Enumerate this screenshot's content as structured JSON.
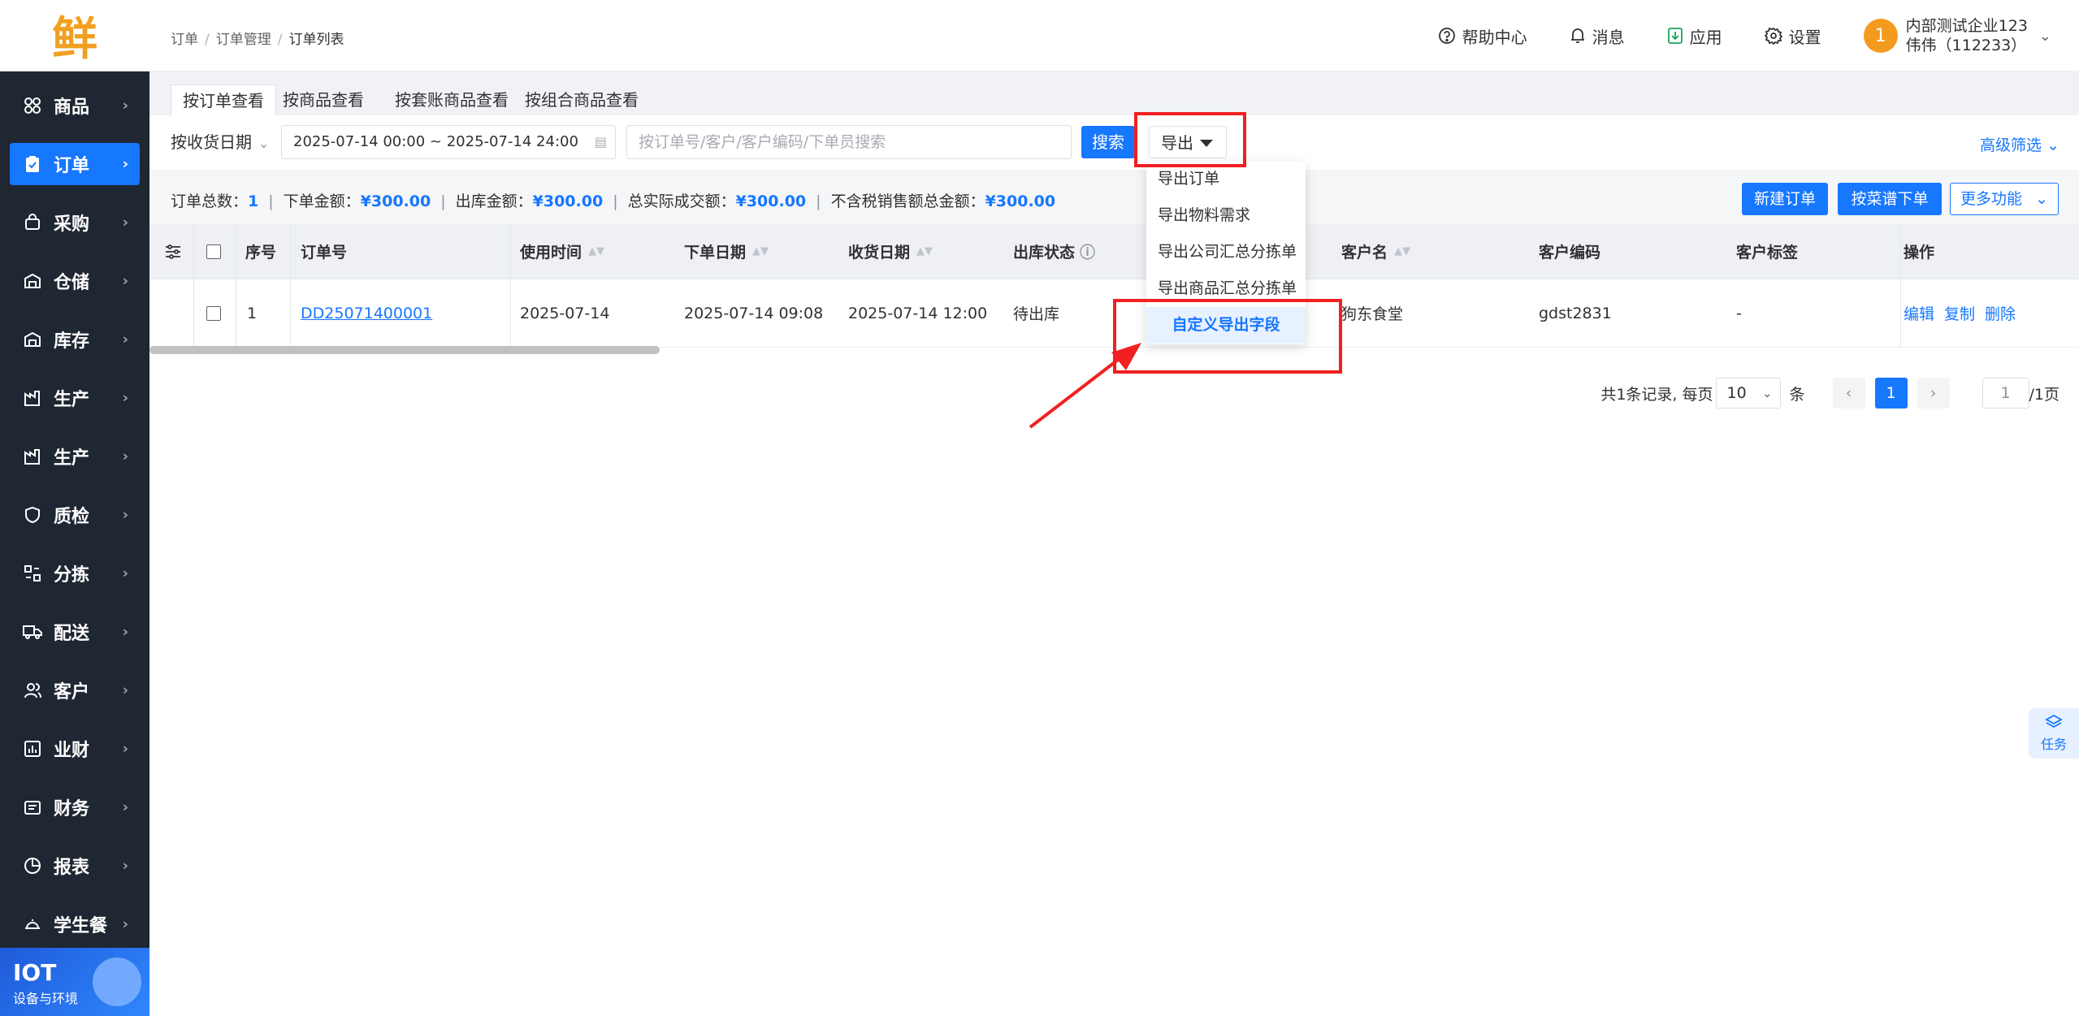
{
  "logo": {
    "text": "鲜",
    "color": "#f0a020"
  },
  "sidebar": {
    "items": [
      {
        "label": "商品",
        "icon": "apps-icon",
        "active": false
      },
      {
        "label": "订单",
        "icon": "clipboard-icon",
        "active": true
      },
      {
        "label": "采购",
        "icon": "shopping-bag-icon",
        "active": false
      },
      {
        "label": "仓储",
        "icon": "warehouse-icon",
        "active": false
      },
      {
        "label": "库存",
        "icon": "inventory-icon",
        "active": false
      },
      {
        "label": "生产",
        "icon": "factory-icon",
        "active": false
      },
      {
        "label": "生产",
        "icon": "factory-icon",
        "active": false
      },
      {
        "label": "质检",
        "icon": "shield-icon",
        "active": false
      },
      {
        "label": "分拣",
        "icon": "sort-icon",
        "active": false
      },
      {
        "label": "配送",
        "icon": "truck-icon",
        "active": false
      },
      {
        "label": "客户",
        "icon": "users-icon",
        "active": false
      },
      {
        "label": "业财",
        "icon": "bar-chart-icon",
        "active": false
      },
      {
        "label": "财务",
        "icon": "wallet-icon",
        "active": false
      },
      {
        "label": "报表",
        "icon": "pie-chart-icon",
        "active": false
      },
      {
        "label": "学生餐",
        "icon": "dish-icon",
        "active": false
      }
    ],
    "iot": {
      "title": "IOT",
      "subtitle": "设备与环境"
    }
  },
  "header": {
    "breadcrumb": [
      "订单",
      "订单管理",
      "订单列表"
    ],
    "help": "帮助中心",
    "messages": "消息",
    "apps": "应用",
    "settings": "设置",
    "user": {
      "avatar": "1",
      "company": "内部测试企业123",
      "name": "伟伟（112233）"
    }
  },
  "tabs": [
    "按订单查看",
    "按商品查看",
    "按套账商品查看",
    "按组合商品查看"
  ],
  "filter": {
    "date_type": "按收货日期",
    "date_range": "2025-07-14 00:00 ~ 2025-07-14 24:00",
    "search_placeholder": "按订单号/客户/客户编码/下单员搜索",
    "search_button": "搜索",
    "export_button": "导出",
    "advanced": "高级筛选"
  },
  "summary": {
    "order_count_label": "订单总数：",
    "order_count": "1",
    "order_amount_label": "下单金额：",
    "order_amount": "¥300.00",
    "outbound_amount_label": "出库金额：",
    "outbound_amount": "¥300.00",
    "actual_amount_label": "总实际成交额：",
    "actual_amount": "¥300.00",
    "notax_amount_label": "不含税销售额总金额：",
    "notax_amount": "¥300.00",
    "new_order": "新建订单",
    "menu_order": "按菜谱下单",
    "more": "更多功能"
  },
  "table": {
    "headers": {
      "index": "序号",
      "order_no": "订单号",
      "use_time": "使用时间",
      "order_date": "下单日期",
      "receive_date": "收货日期",
      "out_status": "出库状态",
      "customer": "客户名",
      "customer_code": "客户编码",
      "customer_tag": "客户标签",
      "ops": "操作"
    },
    "rows": [
      {
        "index": "1",
        "order_no": "DD25071400001",
        "use_time": "2025-07-14",
        "order_date": "2025-07-14 09:08",
        "receive_date": "2025-07-14 12:00",
        "out_status": "待出库",
        "customer": "狗东食堂",
        "customer_code": "gdst2831",
        "customer_tag": "-",
        "edit": "编辑",
        "copy": "复制",
        "delete": "删除"
      }
    ]
  },
  "pagination": {
    "summary": "共1条记录, 每页",
    "page_size": "10",
    "unit": "条",
    "current": "1",
    "jump": "1",
    "total_pages": "/1页"
  },
  "export_menu": {
    "items": [
      "导出订单",
      "导出物料需求",
      "导出公司汇总分拣单",
      "导出商品汇总分拣单",
      "自定义导出字段"
    ],
    "highlighted": "自定义导出字段"
  },
  "task_button": "任务",
  "colors": {
    "primary": "#1677ff",
    "sidebar": "#1f2733",
    "annotation": "#f02020"
  }
}
